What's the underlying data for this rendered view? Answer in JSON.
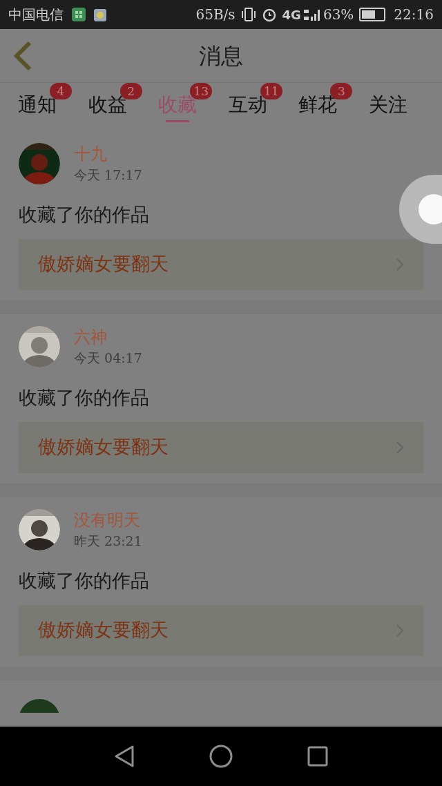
{
  "status_bar": {
    "carrier": "中国电信",
    "speed": "65B/s",
    "network": "4G",
    "battery_percent": "63%",
    "time": "22:16"
  },
  "header": {
    "title": "消息"
  },
  "tabs": [
    {
      "label": "通知",
      "badge": "4",
      "selected": false
    },
    {
      "label": "收益",
      "badge": "2",
      "selected": false
    },
    {
      "label": "收藏",
      "badge": "13",
      "selected": true
    },
    {
      "label": "互动",
      "badge": "11",
      "selected": false
    },
    {
      "label": "鲜花",
      "badge": "3",
      "selected": false
    },
    {
      "label": "关注",
      "selected": false
    }
  ],
  "messages": [
    {
      "name": "十九",
      "time": "今天 17:17",
      "action": "收藏了你的作品",
      "work_title": "傲娇嫡女要翻天"
    },
    {
      "name": "六神",
      "time": "今天 04:17",
      "action": "收藏了你的作品",
      "work_title": "傲娇嫡女要翻天"
    },
    {
      "name": "没有明天",
      "time": "昨天 23:21",
      "action": "收藏了你的作品",
      "work_title": "傲娇嫡女要翻天"
    }
  ]
}
